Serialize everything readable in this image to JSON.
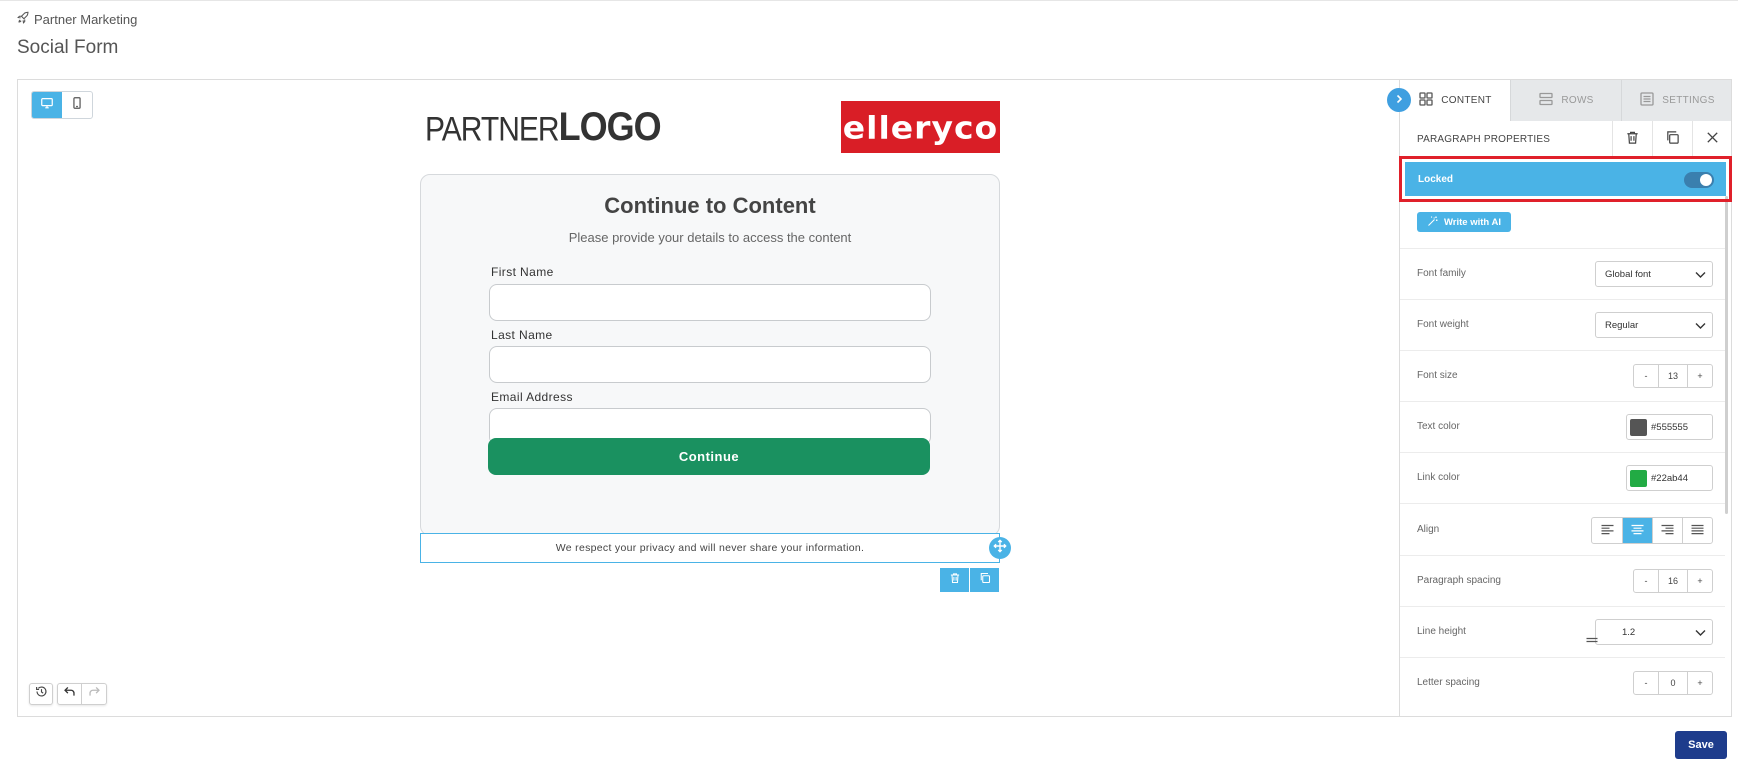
{
  "breadcrumb": {
    "label": "Partner Marketing"
  },
  "page": {
    "title": "Social Form"
  },
  "canvas": {
    "logo_left": {
      "light": "PARTNER",
      "bold": "LOGO"
    },
    "logo_right": {
      "text": "elleryco",
      "color": "#d91e26"
    },
    "form": {
      "heading": "Continue to Content",
      "subheading": "Please provide your details to access the content",
      "fields": [
        {
          "label": "First Name",
          "value": ""
        },
        {
          "label": "Last Name",
          "value": ""
        },
        {
          "label": "Email Address",
          "value": ""
        }
      ],
      "button_label": "Continue",
      "button_color": "#1a9160"
    },
    "privacy_text": "We respect your privacy and will never share your information."
  },
  "sidebar": {
    "tabs": [
      {
        "label": "CONTENT",
        "icon": "grid-icon",
        "active": true
      },
      {
        "label": "ROWS",
        "icon": "rows-icon",
        "active": false
      },
      {
        "label": "SETTINGS",
        "icon": "settings-list-icon",
        "active": false
      }
    ],
    "section_title": "PARAGRAPH PROPERTIES",
    "locked": {
      "label": "Locked",
      "on": true
    },
    "ai_button": "Write with AI",
    "properties": {
      "font_family": {
        "label": "Font family",
        "value": "Global font"
      },
      "font_weight": {
        "label": "Font weight",
        "value": "Regular"
      },
      "font_size": {
        "label": "Font size",
        "minus": "-",
        "value": "13",
        "plus": "+"
      },
      "text_color": {
        "label": "Text color",
        "value": "#555555",
        "swatch": "#555555"
      },
      "link_color": {
        "label": "Link color",
        "value": "#22ab44",
        "swatch": "#22ab44"
      },
      "align": {
        "label": "Align",
        "selected": "center"
      },
      "paragraph_spacing": {
        "label": "Paragraph spacing",
        "minus": "-",
        "value": "16",
        "plus": "+"
      },
      "line_height": {
        "label": "Line height",
        "value": "1.2"
      },
      "letter_spacing": {
        "label": "Letter spacing",
        "minus": "-",
        "value": "0",
        "plus": "+"
      }
    }
  },
  "footer": {
    "save_label": "Save"
  },
  "colors": {
    "accent": "#4ab3e6",
    "save": "#1e3c8c",
    "highlight": "#e0202a"
  }
}
